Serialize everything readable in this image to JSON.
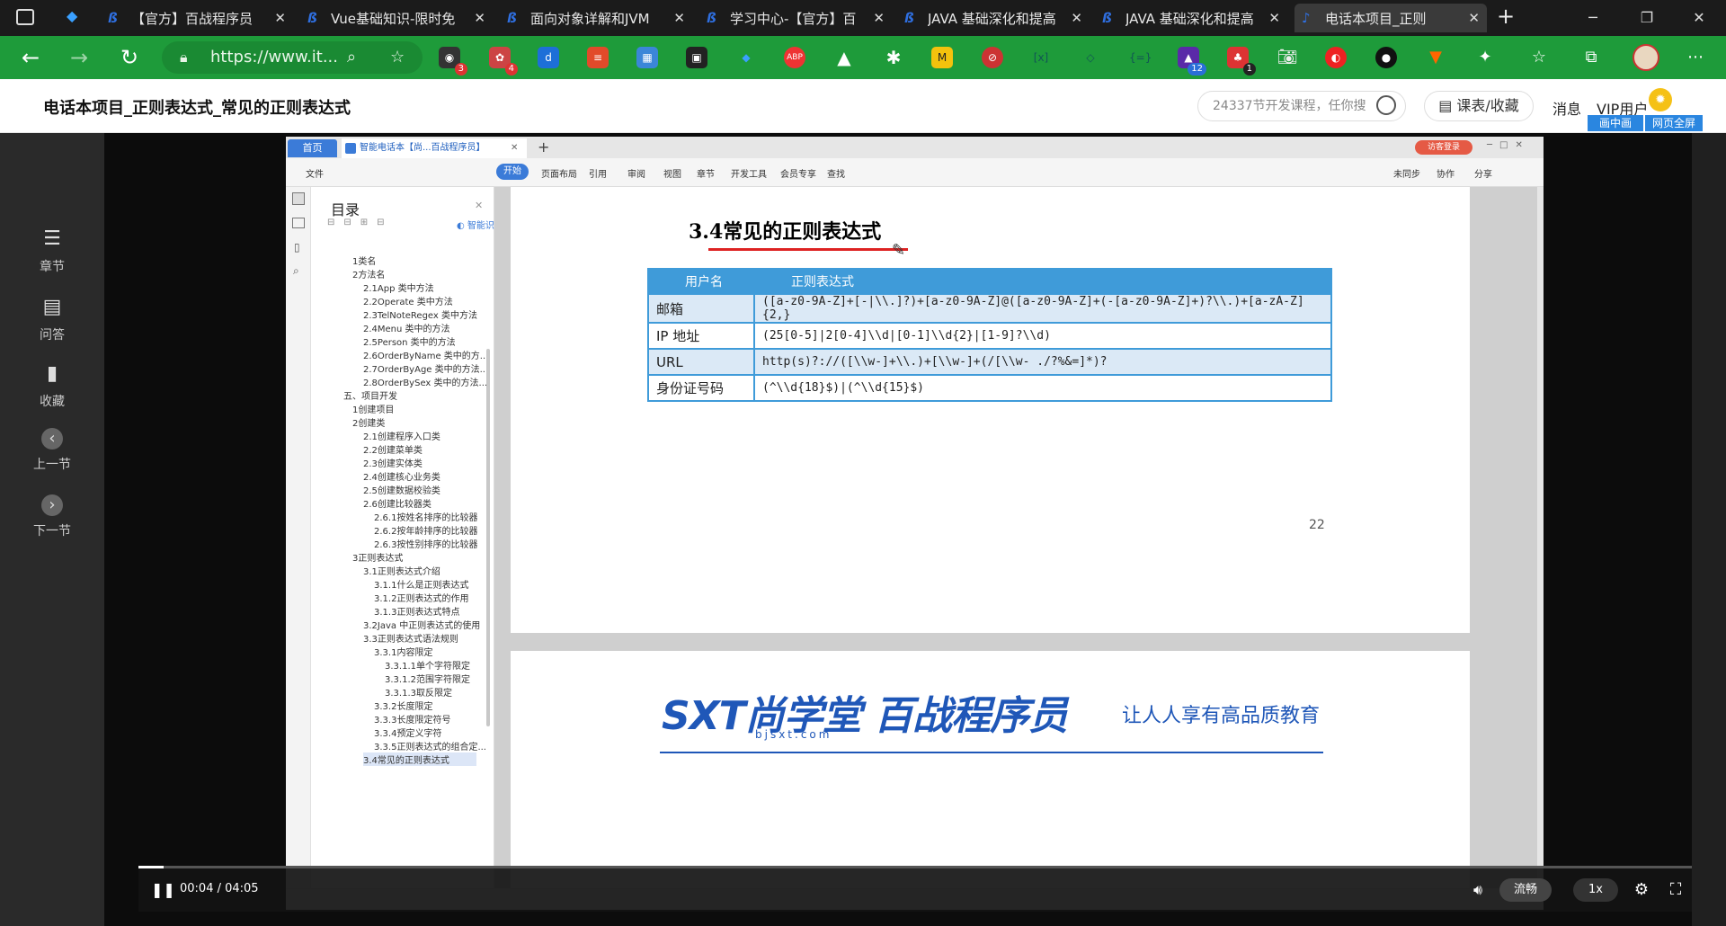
{
  "browser": {
    "tabs": [
      {
        "title": "【官方】百战程序员",
        "active": false
      },
      {
        "title": "Vue基础知识-限时免",
        "active": false
      },
      {
        "title": "面向对象详解和JVM",
        "active": false
      },
      {
        "title": "学习中心-【官方】百",
        "active": false
      },
      {
        "title": "JAVA 基础深化和提高",
        "active": false
      },
      {
        "title": "JAVA 基础深化和提高",
        "active": false
      },
      {
        "title": "电话本项目_正则",
        "active": true
      }
    ],
    "url": "https://www.it...",
    "extension_badges": {
      "ext1": "3",
      "ext2": "4",
      "ext3": "12",
      "ext4": "1"
    },
    "accent": "#1e9b3a"
  },
  "site": {
    "page_title": "电话本项目_正则表达式_常见的正则表达式",
    "search_placeholder": "24337节开发课程，任你搜",
    "kebiao": "课表/收藏",
    "messages": "消息",
    "vip": "VIP用户",
    "pip": "画中画",
    "webfull": "网页全屏"
  },
  "leftnav": {
    "items": [
      {
        "label": "章节",
        "icon": "chapters-icon"
      },
      {
        "label": "问答",
        "icon": "qa-icon"
      },
      {
        "label": "收藏",
        "icon": "bookmark-icon"
      },
      {
        "label": "上一节",
        "icon": "prev-icon"
      },
      {
        "label": "下一节",
        "icon": "next-icon"
      }
    ]
  },
  "wps": {
    "home_tab": "首页",
    "doc_tab": "智能电话本【尚...百战程序员】",
    "login": "访客登录",
    "menu": [
      "文件",
      "开始",
      "插入",
      "页面布局",
      "引用",
      "审阅",
      "视图",
      "章节",
      "开发工具",
      "会员专享",
      "查找"
    ],
    "right_menu": [
      "未同步",
      "协作",
      "分享"
    ],
    "toc_title": "目录",
    "toc_smart": "智能识别目录",
    "toc": [
      "1类名",
      "2方法名",
      "2.1App 类中方法",
      "2.2Operate 类中方法",
      "2.3TelNoteRegex 类中方法",
      "2.4Menu 类中的方法",
      "2.5Person 类中的方法",
      "2.6OrderByName 类中的方...",
      "2.7OrderByAge 类中的方法...",
      "2.8OrderBySex 类中的方法...",
      "五、项目开发",
      "1创建项目",
      "2创建类",
      "2.1创建程序入口类",
      "2.2创建菜单类",
      "2.3创建实体类",
      "2.4创建核心业务类",
      "2.5创建数据校验类",
      "2.6创建比较器类",
      "2.6.1按姓名排序的比较器",
      "2.6.2按年龄排序的比较器",
      "2.6.3按性别排序的比较器",
      "3正则表达式",
      "3.1正则表达式介绍",
      "3.1.1什么是正则表达式",
      "3.1.2正则表达式的作用",
      "3.1.3正则表达式特点",
      "3.2Java 中正则表达式的使用",
      "3.3正则表达式语法规则",
      "3.3.1内容限定",
      "3.3.1.1单个字符限定",
      "3.3.1.2范围字符限定",
      "3.3.1.3取反限定",
      "3.3.2长度限定",
      "3.3.3长度限定符号",
      "3.3.4预定义字符",
      "3.3.5正则表达式的组合定...",
      "3.4常见的正则表达式"
    ],
    "section_title": "3.4常见的正则表达式",
    "table": {
      "headers": [
        "用户名",
        "正则表达式"
      ],
      "rows": [
        {
          "name": "邮箱",
          "regex": "([a-z0-9A-Z]+[-|\\\\.]?)+[a-z0-9A-Z]@([a-z0-9A-Z]+(-[a-z0-9A-Z]+)?\\\\.)+[a-zA-Z]{2,}"
        },
        {
          "name": "IP 地址",
          "regex": "(25[0-5]|2[0-4]\\\\d|[0-1]\\\\d{2}|[1-9]?\\\\d)"
        },
        {
          "name": "URL",
          "regex": "http(s)?://([\\\\w-]+\\\\.)+[\\\\w-]+(/[\\\\w- ./?%&=]*)?"
        },
        {
          "name": "身份证号码",
          "regex": "(^\\\\d{18}$)|(^\\\\d{15}$)"
        }
      ]
    },
    "page_number": "22",
    "logo_text": "SXT尚学堂 百战程序员",
    "logo_sub": "bjsxt.com",
    "slogan": "让人人享有高品质教育"
  },
  "player": {
    "time": "00:04 / 04:05",
    "progress": 0.016,
    "quality": "流畅",
    "speed": "1x"
  }
}
